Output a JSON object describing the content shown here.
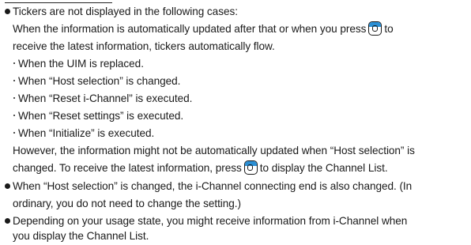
{
  "note": {
    "bullet1": {
      "text": "Tickers are not displayed in the following cases:",
      "line2_pre": "When the information is automatically updated after that or when you press",
      "line2_post": "to",
      "line3": "receive the latest information, tickers automatically flow.",
      "cases": [
        "When the UIM is replaced.",
        "When “Host selection” is changed.",
        "When “Reset i-Channel” is executed.",
        "When “Reset settings” is executed.",
        "When “Initialize” is executed."
      ],
      "however_line1": "However, the information might not be automatically updated when “Host selection” is",
      "however_line2_pre": "changed. To receive the latest information, press",
      "however_line2_post": "to display the Channel List."
    },
    "bullet2": {
      "line1": "When “Host selection” is changed, the i-Channel connecting end is also changed. (In",
      "line2": "ordinary, you do not need to change the setting.)"
    },
    "bullet3": {
      "line1": "Depending on your usage state, you might receive information from i-Channel when",
      "line2": "you display the Channel List."
    }
  },
  "icons": {
    "key": "i-channel-key-icon"
  },
  "colors": {
    "key_accent": "#2b8fd4",
    "text": "#1a1a1a"
  }
}
